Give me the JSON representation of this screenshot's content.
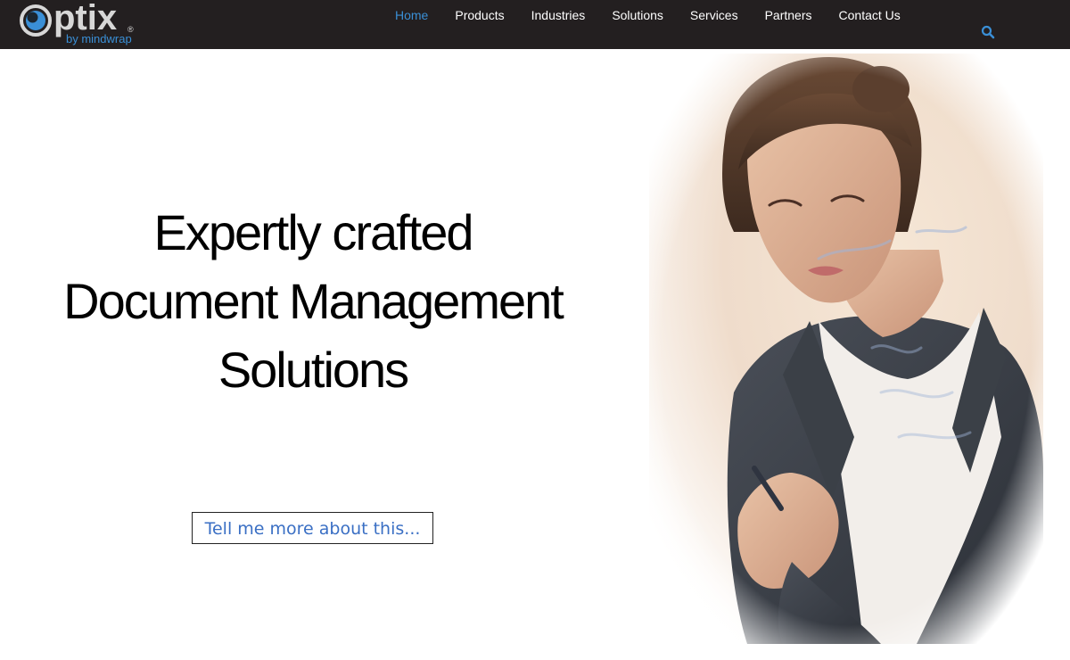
{
  "brand": {
    "name": "ptix",
    "registered": "®",
    "tagline": "by mindwrap",
    "accent_color": "#3a8fd6"
  },
  "nav": {
    "items": [
      {
        "label": "Home",
        "active": true
      },
      {
        "label": "Products",
        "active": false
      },
      {
        "label": "Industries",
        "active": false
      },
      {
        "label": "Solutions",
        "active": false
      },
      {
        "label": "Services",
        "active": false
      },
      {
        "label": "Partners",
        "active": false
      },
      {
        "label": "Contact Us",
        "active": false
      }
    ],
    "search_icon": "search-icon"
  },
  "hero": {
    "headline_lines": [
      "Expertly crafted",
      "Document Management",
      "Solutions"
    ],
    "cta_label": "Tell me more about this...",
    "image": "businesswoman-writing-on-glass-board"
  }
}
